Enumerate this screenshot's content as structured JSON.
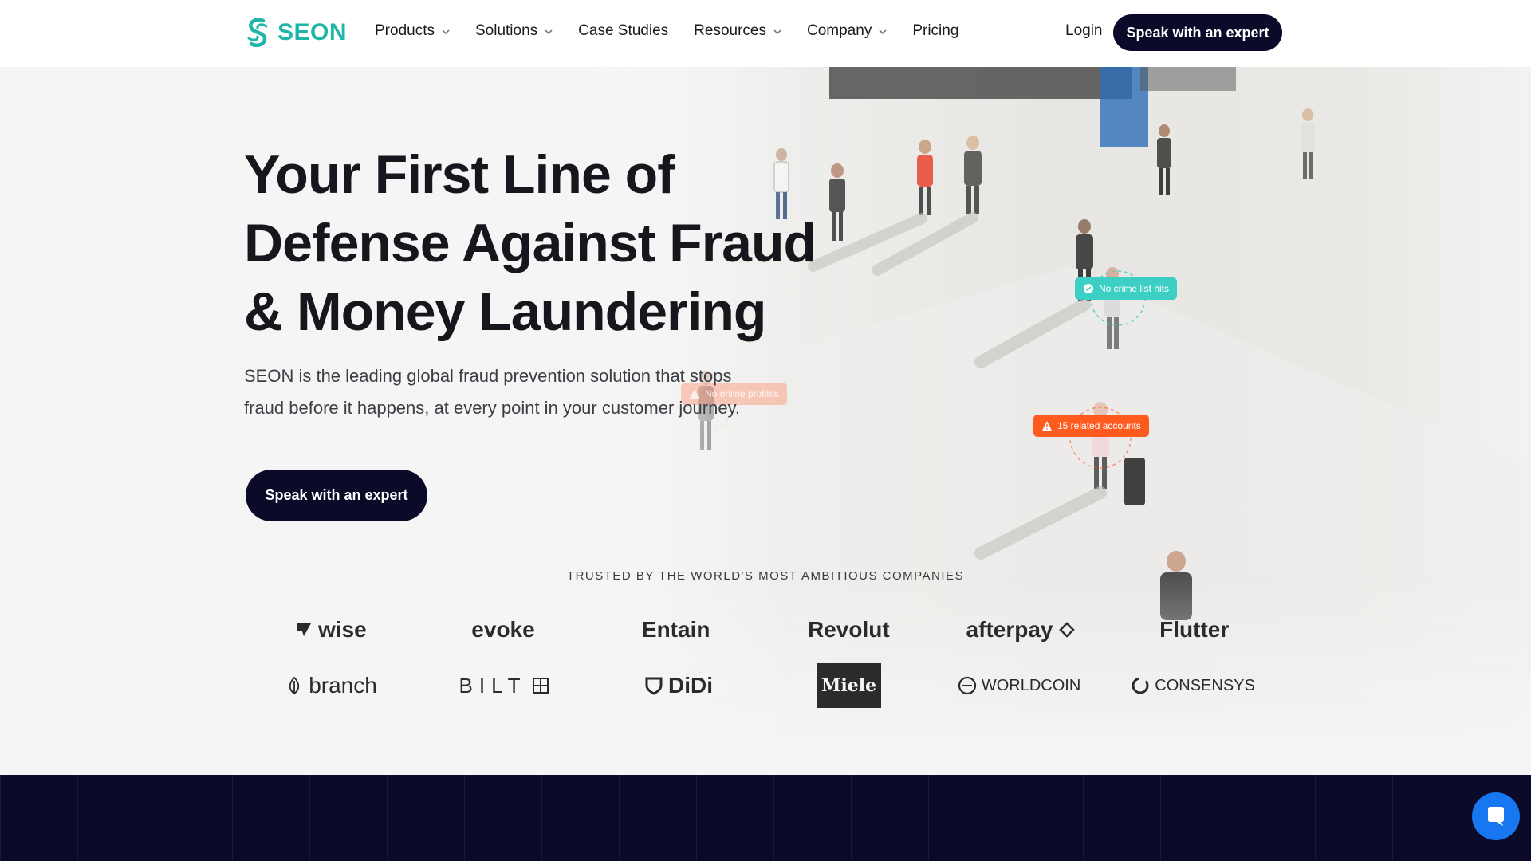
{
  "brand": {
    "name": "SEON",
    "accent_color": "#1fb5a7"
  },
  "nav": {
    "items": [
      {
        "label": "Products",
        "has_dropdown": true
      },
      {
        "label": "Solutions",
        "has_dropdown": true
      },
      {
        "label": "Case Studies",
        "has_dropdown": false
      },
      {
        "label": "Resources",
        "has_dropdown": true
      },
      {
        "label": "Company",
        "has_dropdown": true
      },
      {
        "label": "Pricing",
        "has_dropdown": false
      }
    ],
    "login_label": "Login",
    "cta_label": "Speak with an expert"
  },
  "hero": {
    "title_lines": [
      "Your First Line of",
      "Defense Against Fraud",
      "& Money Laundering"
    ],
    "subtitle_lines": [
      "SEON is the leading global fraud prevention solution that stops",
      "fraud before it happens, at every point in your customer journey."
    ],
    "cta_label": "Speak with an expert",
    "tags": {
      "teal": "No crime list hits",
      "orange": "15 related accounts",
      "faint": "No online profiles"
    }
  },
  "trusted": {
    "heading": "TRUSTED BY THE WORLD'S MOST AMBITIOUS COMPANIES",
    "row1": [
      "wise",
      "evoke",
      "Entain",
      "Revolut",
      "afterpay",
      "Flutter"
    ],
    "row2": [
      "branch",
      "BILT",
      "DiDi",
      "Miele",
      "WORLDCOIN",
      "CONSENSYS"
    ]
  },
  "colors": {
    "dark_navy": "#0b0a28",
    "chat_blue": "#1677f0",
    "tag_teal": "#3ecfc4",
    "tag_orange": "#ff5b1f"
  }
}
